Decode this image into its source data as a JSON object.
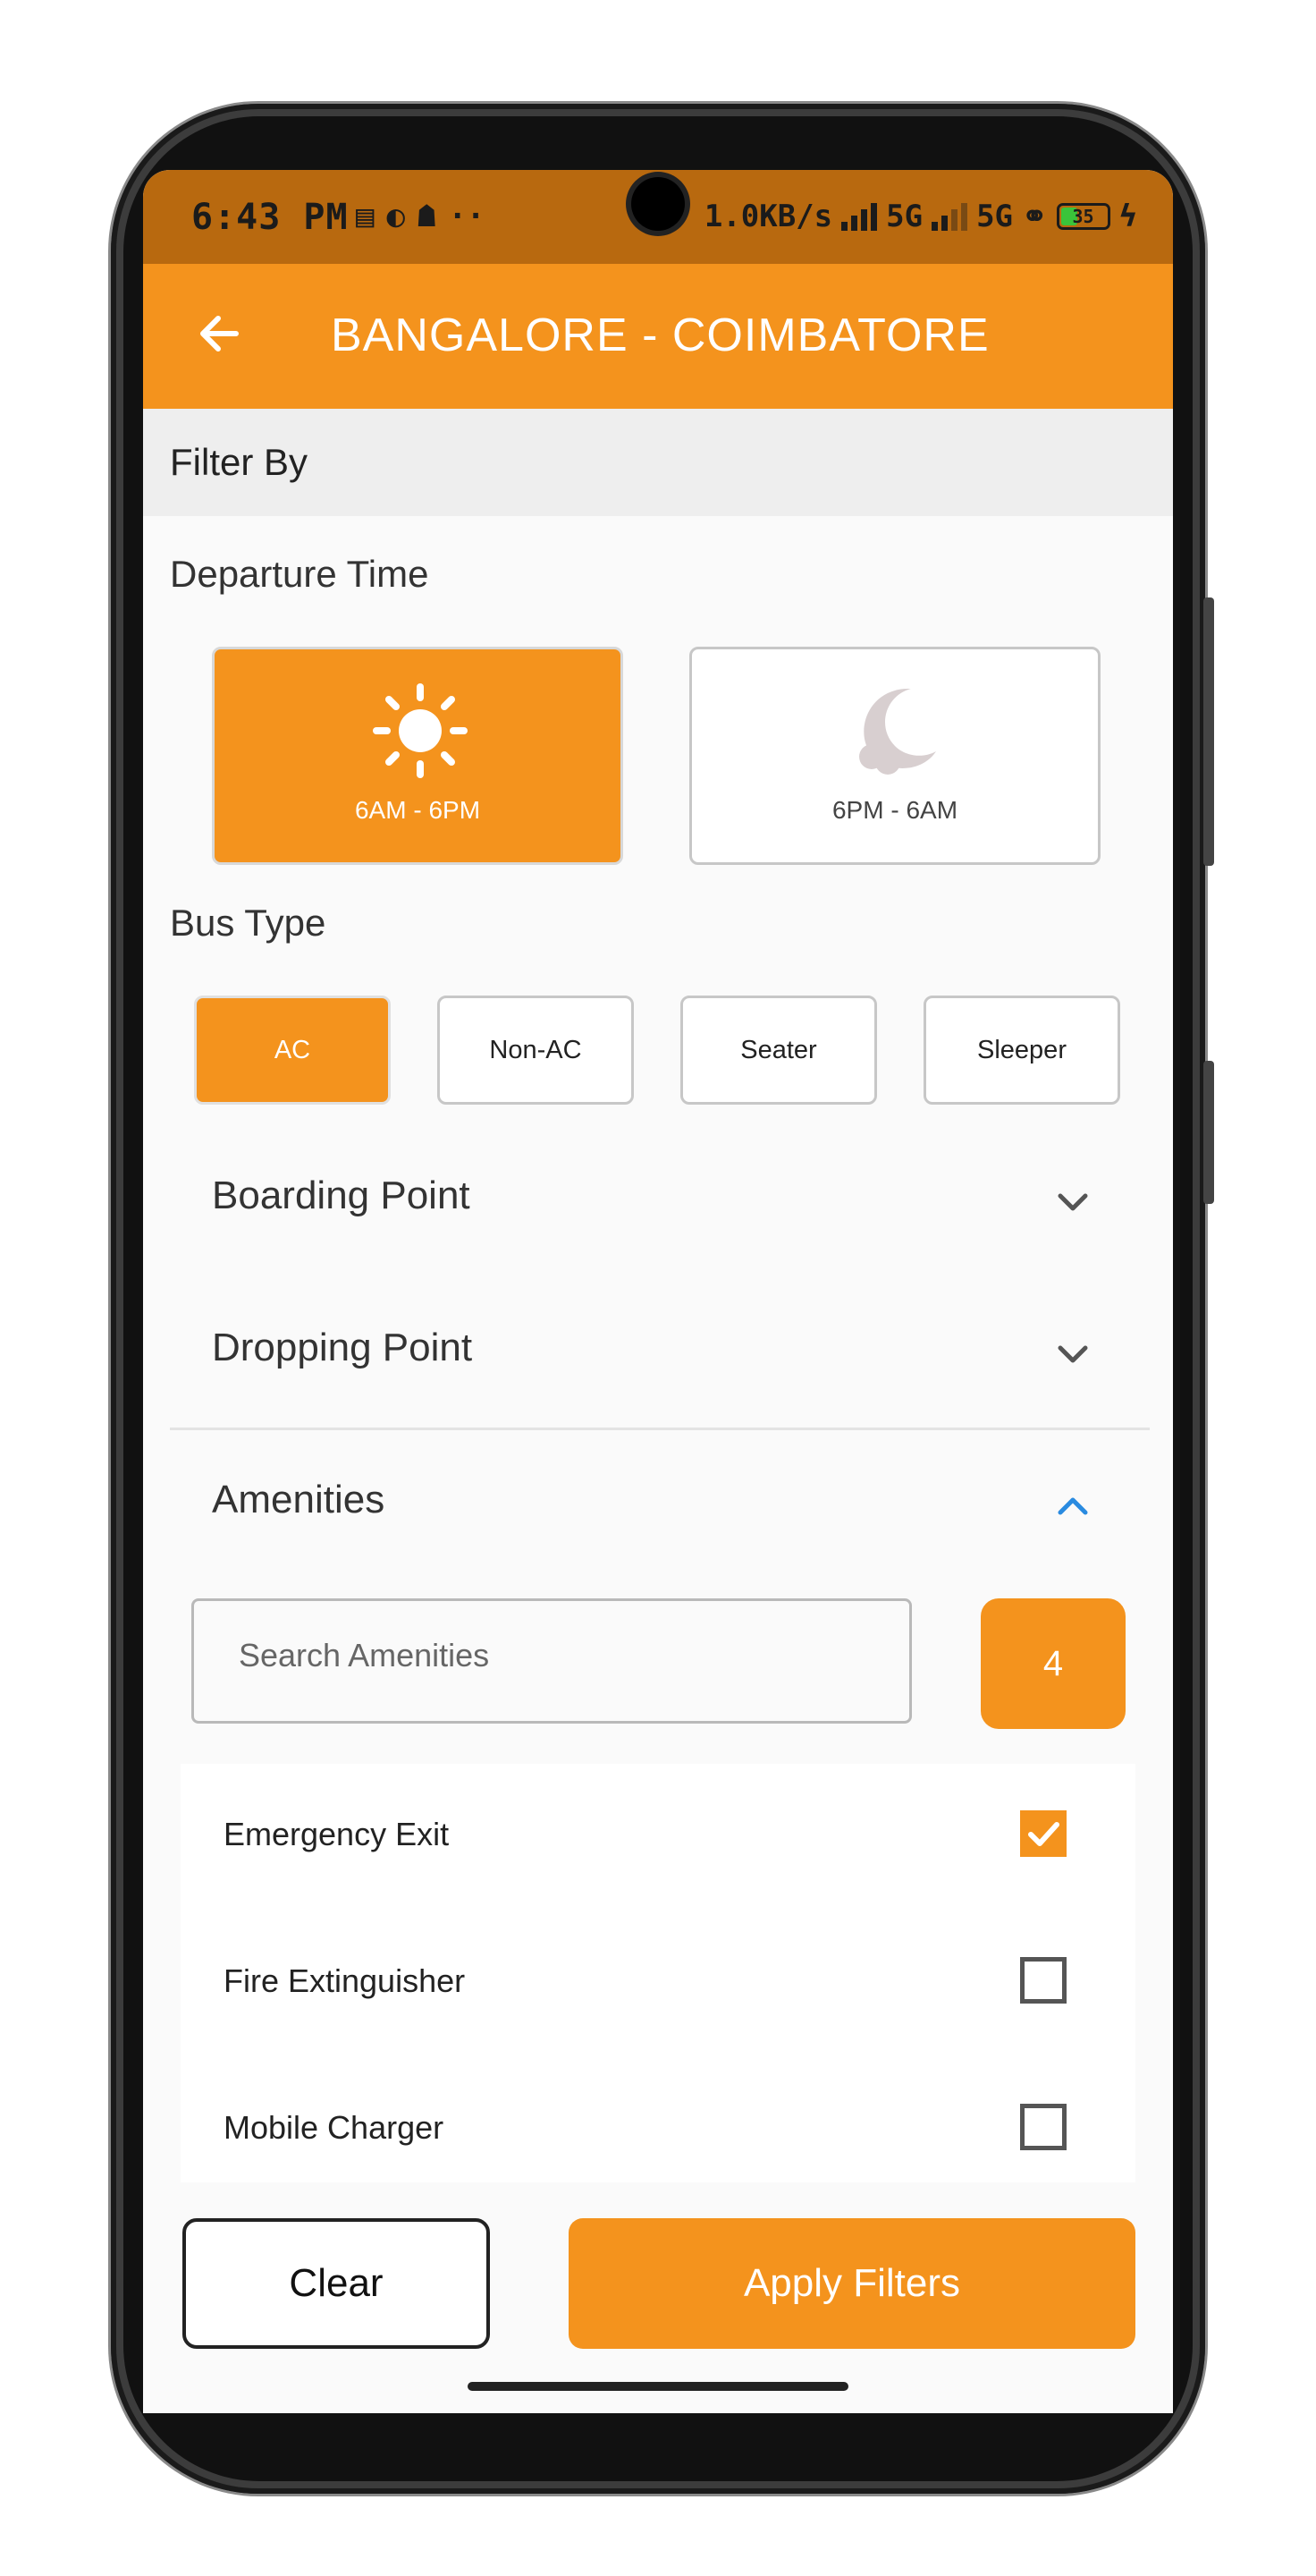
{
  "status_bar": {
    "time": "6:43 PM",
    "net_speed": "1.0KB/s",
    "network_1": "5G",
    "network_2": "5G",
    "battery_level": "35"
  },
  "header": {
    "title": "BANGALORE - COIMBATORE"
  },
  "filter_by_label": "Filter By",
  "departure": {
    "label": "Departure Time",
    "options": [
      {
        "label": "6AM - 6PM",
        "icon": "sun-icon",
        "selected": true
      },
      {
        "label": "6PM - 6AM",
        "icon": "moon-icon",
        "selected": false
      }
    ]
  },
  "bus_type": {
    "label": "Bus Type",
    "options": [
      {
        "label": "AC",
        "selected": true
      },
      {
        "label": "Non-AC",
        "selected": false
      },
      {
        "label": "Seater",
        "selected": false
      },
      {
        "label": "Sleeper",
        "selected": false
      }
    ]
  },
  "sections": {
    "boarding": {
      "label": "Boarding Point",
      "expanded": false
    },
    "dropping": {
      "label": "Dropping Point",
      "expanded": false
    },
    "amenities": {
      "label": "Amenities",
      "expanded": true
    }
  },
  "amenities": {
    "search_placeholder": "Search Amenities",
    "search_value": "",
    "count": "4",
    "items": [
      {
        "label": "Emergency Exit",
        "checked": true
      },
      {
        "label": "Fire Extinguisher",
        "checked": false
      },
      {
        "label": "Mobile Charger",
        "checked": false
      }
    ]
  },
  "actions": {
    "clear_label": "Clear",
    "apply_label": "Apply Filters"
  },
  "colors": {
    "accent": "#f4931d",
    "status_bar": "#b8690f",
    "expanded_chevron": "#2a8be0"
  }
}
